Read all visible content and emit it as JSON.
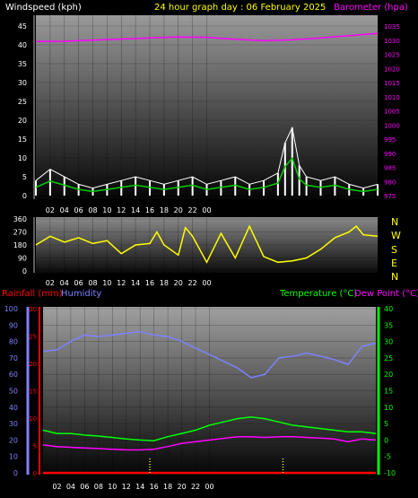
{
  "header": {
    "wind_label": "Windspeed (kph)",
    "title": "24 hour graph day : 06 February 2025",
    "baro_label": "Barometer (hpa)"
  },
  "middle": {
    "compass": [
      "N",
      "W",
      "S",
      "E",
      "N"
    ]
  },
  "lower_header": {
    "rain_label": "Rainfall (mm)",
    "humidity_label": "Humidity",
    "temp_label": "Temperature (°C)",
    "dew_label": "Dew Point (°C)"
  },
  "colors": {
    "wind": "#ffffff",
    "wind_avg": "#00cc00",
    "barometer": "#ff00ff",
    "direction": "#ffff00",
    "humidity": "#8080ff",
    "temperature": "#00ff00",
    "dewpoint": "#ff00ff",
    "rain": "#ff0000",
    "title": "#ffff00"
  },
  "chart_data": [
    {
      "type": "line",
      "title": "24 hour graph day : 06 February 2025",
      "xlabel": "",
      "x_ticks": [
        "02",
        "04",
        "06",
        "08",
        "10",
        "12",
        "14",
        "16",
        "18",
        "20",
        "22",
        "00"
      ],
      "left_axis": {
        "label": "Windspeed (kph)",
        "range": [
          0,
          45
        ],
        "ticks": [
          0,
          5,
          10,
          15,
          20,
          25,
          30,
          35,
          40,
          45
        ]
      },
      "right_axis": {
        "label": "Barometer (hpa)",
        "range": [
          975,
          1035
        ],
        "ticks": [
          975,
          980,
          985,
          990,
          995,
          1000,
          1005,
          1010,
          1015,
          1020,
          1025,
          1030,
          1035
        ]
      },
      "series": [
        {
          "name": "Windspeed (kph)",
          "axis": "left",
          "x": [
            0,
            1,
            2,
            3,
            4,
            5,
            6,
            7,
            8,
            9,
            10,
            11,
            12,
            13,
            14,
            15,
            16,
            17,
            17.5,
            18,
            18.5,
            19,
            20,
            21,
            22,
            23,
            24
          ],
          "values": [
            4,
            7,
            5,
            3,
            2,
            3,
            4,
            5,
            4,
            3,
            4,
            5,
            3,
            4,
            5,
            3,
            4,
            6,
            14,
            18,
            8,
            5,
            4,
            5,
            3,
            2,
            3
          ]
        },
        {
          "name": "Barometer (hpa)",
          "axis": "right",
          "x": [
            0,
            2,
            4,
            6,
            8,
            10,
            12,
            14,
            16,
            18,
            20,
            22,
            24
          ],
          "values": [
            1029.5,
            1029.6,
            1030.0,
            1030.4,
            1030.8,
            1031.1,
            1031.0,
            1030.3,
            1029.8,
            1030.1,
            1030.8,
            1031.6,
            1032.4
          ]
        }
      ]
    },
    {
      "type": "line",
      "title": "",
      "x_ticks": [
        "02",
        "04",
        "06",
        "08",
        "10",
        "12",
        "14",
        "16",
        "18",
        "20",
        "22",
        "00"
      ],
      "left_axis": {
        "label": "",
        "range": [
          0,
          360
        ],
        "ticks": [
          0,
          90,
          180,
          270,
          360
        ]
      },
      "series": [
        {
          "name": "",
          "x": [
            0,
            1,
            2,
            3,
            4,
            5,
            6,
            7,
            8,
            8.5,
            9,
            10,
            10.5,
            11,
            12,
            13,
            14,
            15,
            16,
            17,
            18,
            19,
            20,
            21,
            22,
            22.5,
            23,
            24
          ],
          "values": [
            180,
            240,
            200,
            230,
            190,
            210,
            120,
            180,
            190,
            270,
            180,
            110,
            300,
            240,
            60,
            260,
            90,
            310,
            100,
            60,
            70,
            90,
            150,
            230,
            270,
            310,
            250,
            240
          ]
        }
      ]
    },
    {
      "type": "line",
      "title": "",
      "x_ticks": [
        "02",
        "04",
        "06",
        "08",
        "10",
        "12",
        "14",
        "16",
        "18",
        "20",
        "22",
        "00"
      ],
      "left_axis": {
        "label": "Humidity",
        "range": [
          0,
          100
        ],
        "ticks": [
          0,
          10,
          20,
          30,
          40,
          50,
          60,
          70,
          80,
          90,
          100
        ]
      },
      "rain_axis": {
        "label": "Rainfall (mm)",
        "range": [
          0,
          30
        ],
        "ticks": [
          0,
          5,
          10,
          15,
          20,
          25,
          30
        ]
      },
      "right_axis": {
        "label": "Temperature (°C)",
        "range": [
          -10,
          40
        ],
        "ticks": [
          -10,
          -5,
          0,
          5,
          10,
          15,
          20,
          25,
          30,
          35,
          40
        ]
      },
      "series": [
        {
          "name": "Humidity",
          "axis": "left",
          "x": [
            0,
            1,
            2,
            3,
            4,
            5,
            6,
            7,
            8,
            9,
            10,
            11,
            12,
            13,
            14,
            15,
            16,
            17,
            18,
            19,
            20,
            21,
            22,
            23,
            24
          ],
          "values": [
            74,
            75,
            80,
            84,
            83,
            84,
            85,
            86,
            84,
            83,
            80,
            76,
            72,
            68,
            64,
            58,
            60,
            70,
            71,
            73,
            71,
            69,
            66,
            77,
            79
          ]
        },
        {
          "name": "Temperature (°C)",
          "axis": "right",
          "x": [
            0,
            1,
            2,
            3,
            4,
            5,
            6,
            7,
            8,
            9,
            10,
            11,
            12,
            13,
            14,
            15,
            16,
            17,
            18,
            19,
            20,
            21,
            22,
            23,
            24
          ],
          "values": [
            3,
            2,
            2,
            1.5,
            1.2,
            0.8,
            0.3,
            0,
            -0.2,
            1,
            2,
            3,
            4.5,
            5.5,
            6.5,
            7,
            6.5,
            5.5,
            4.5,
            4,
            3.5,
            3,
            2.5,
            2.5,
            2
          ]
        },
        {
          "name": "Dew Point (°C)",
          "axis": "right",
          "x": [
            0,
            1,
            2,
            3,
            4,
            5,
            6,
            7,
            8,
            9,
            10,
            11,
            12,
            13,
            14,
            15,
            16,
            17,
            18,
            19,
            20,
            21,
            22,
            23,
            24
          ],
          "values": [
            -1.5,
            -2,
            -2.2,
            -2.4,
            -2.6,
            -2.8,
            -3,
            -3,
            -2.8,
            -2,
            -1,
            -0.5,
            0,
            0.5,
            1,
            1,
            0.8,
            1,
            1,
            0.8,
            0.6,
            0.3,
            -0.5,
            0.3,
            0
          ]
        },
        {
          "name": "Rainfall (mm)",
          "axis": "rain",
          "x": [
            0,
            24
          ],
          "values": [
            0,
            0
          ]
        }
      ]
    }
  ]
}
